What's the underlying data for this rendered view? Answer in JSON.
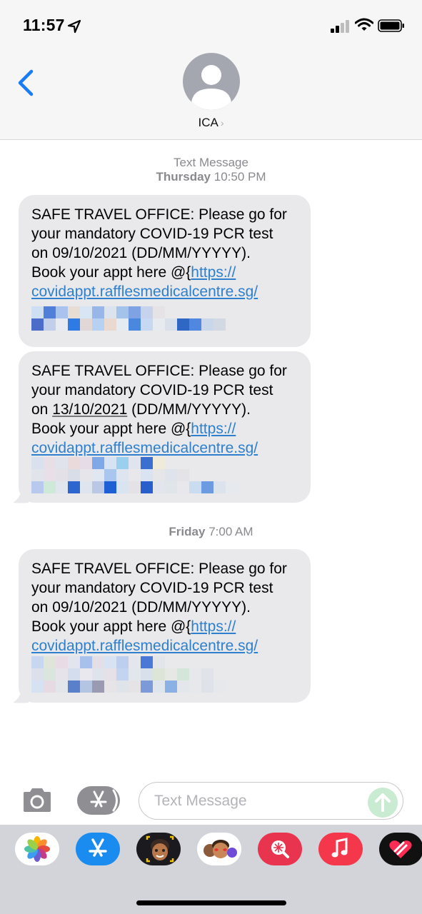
{
  "status_bar": {
    "time": "11:57"
  },
  "header": {
    "contact_name": "ICA",
    "contact_chevron": "›"
  },
  "conversation": {
    "first_timestamp": {
      "label": "Text Message",
      "date": "Thursday",
      "time": "10:50 PM"
    },
    "second_timestamp": {
      "date": "Friday",
      "time": "7:00 AM"
    },
    "messages": [
      {
        "line1": "SAFE TRAVEL OFFICE: Please go for",
        "line2": "your mandatory COVID-19 PCR test",
        "line3_prefix": "on ",
        "date": "09/10/2021",
        "line3_suffix": " (DD/MM/YYYYY).",
        "line4_prefix": "Book your appt here @{",
        "link_start": "https://",
        "link_line": "covidappt.rafflesmedicalcentre.sg/"
      },
      {
        "line1": "SAFE TRAVEL OFFICE: Please go for",
        "line2": "your mandatory COVID-19 PCR test",
        "line3_prefix": "on ",
        "date": "13/10/2021",
        "line3_suffix": " (DD/MM/YYYYY).",
        "line4_prefix": "Book your appt here @{",
        "link_start": "https://",
        "link_line": "covidappt.rafflesmedicalcentre.sg/"
      },
      {
        "line1": "SAFE TRAVEL OFFICE: Please go for",
        "line2": "your mandatory COVID-19 PCR test",
        "line3_prefix": "on ",
        "date": "09/10/2021",
        "line3_suffix": " (DD/MM/YYYYY).",
        "line4_prefix": "Book your appt here @{",
        "link_start": "https://",
        "link_line": "covidappt.rafflesmedicalcentre.sg/"
      }
    ]
  },
  "input": {
    "placeholder": "Text Message"
  },
  "colors": {
    "link": "#2e80ce",
    "bubble": "#e9e9eb",
    "ios_blue": "#1a7cf5",
    "send_disabled": "#c9ebd1"
  },
  "icons": {
    "back": "chevron-left-icon",
    "camera": "camera-icon",
    "appstore": "app-store-icon",
    "send": "arrow-up-icon",
    "drawer_apps": [
      "photos-icon",
      "app-store-icon",
      "memoji-icon",
      "memoji-stickers-icon",
      "image-search-icon",
      "music-icon",
      "heart-stickers-icon"
    ]
  }
}
